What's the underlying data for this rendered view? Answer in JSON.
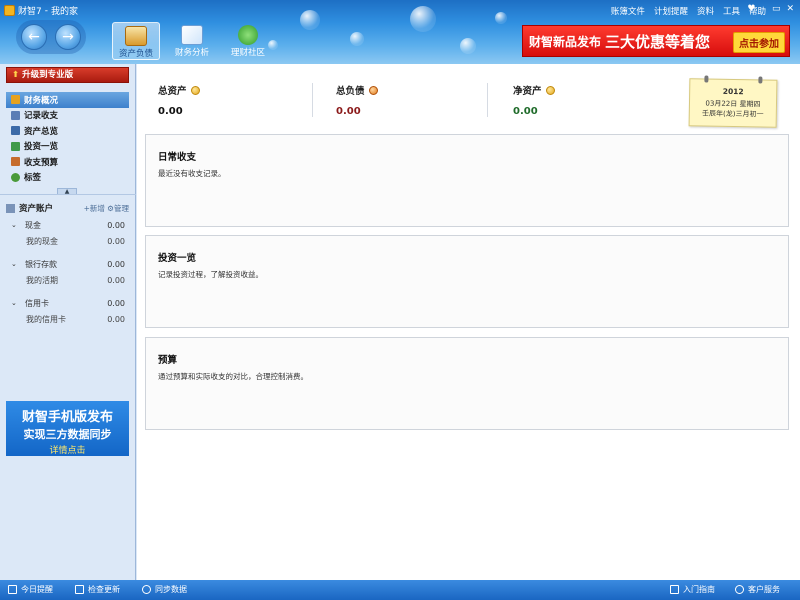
{
  "titlebar": {
    "app_name": "财智7",
    "separator": "-",
    "book_name": "我的家"
  },
  "menu": [
    "账簿文件",
    "计划提醒",
    "资料",
    "工具",
    "帮助"
  ],
  "window_controls": {
    "skin": "♥",
    "minimize": "–",
    "restore": "▭",
    "close": "✕"
  },
  "toolbar": {
    "back_label": "←",
    "forward_label": "→",
    "tools": [
      {
        "label": "资产负债",
        "active": true
      },
      {
        "label": "财务分析",
        "active": false
      },
      {
        "label": "理财社区",
        "active": false
      }
    ]
  },
  "promo": {
    "text": "财智新品发布",
    "highlight": "三大优惠等着您",
    "button": "点击参加"
  },
  "sidebar": {
    "upgrade_label": "升级到专业版",
    "nav": [
      {
        "label": "财务概况",
        "active": true,
        "color": "#e7a21e"
      },
      {
        "label": "记录收支",
        "active": false,
        "color": "#5a7db5"
      },
      {
        "label": "资产总览",
        "active": false,
        "color": "#3b6aa8"
      },
      {
        "label": "投资一览",
        "active": false,
        "color": "#3f9a4a"
      },
      {
        "label": "收支预算",
        "active": false,
        "color": "#c66c2c"
      },
      {
        "label": "标签",
        "active": false,
        "color": "#4a9a3a"
      }
    ],
    "collapse_icon": "▲",
    "accounts": {
      "header": "资产账户",
      "add_label": "+新增",
      "manage_label": "⚙管理",
      "groups": [
        {
          "name": "现金",
          "amount": "0.00",
          "items": [
            {
              "name": "我的现金",
              "amount": "0.00"
            }
          ]
        },
        {
          "name": "银行存款",
          "amount": "0.00",
          "items": [
            {
              "name": "我的活期",
              "amount": "0.00"
            }
          ]
        },
        {
          "name": "信用卡",
          "amount": "0.00",
          "items": [
            {
              "name": "我的信用卡",
              "amount": "0.00"
            }
          ]
        }
      ]
    },
    "banner": {
      "line1": "财智手机版发布",
      "line2": "实现三方数据同步",
      "line3": "详情点击"
    }
  },
  "summary": {
    "total_assets": {
      "label": "总资产",
      "value": "0.00",
      "color": "#111111"
    },
    "total_liabilities": {
      "label": "总负债",
      "value": "0.00",
      "color": "#8b1a1a"
    },
    "net_assets": {
      "label": "净资产",
      "value": "0.00",
      "color": "#1f6b2a"
    }
  },
  "calendar": {
    "year": "2012",
    "date_line": "03月22日 星期四",
    "lunar_line": "壬辰年(龙)三月初一"
  },
  "cards": [
    {
      "title": "日常收支",
      "desc": "最近没有收支记录。"
    },
    {
      "title": "投资一览",
      "desc": "记录投资过程，了解投资收益。"
    },
    {
      "title": "预算",
      "desc": "通过预算和实际收支的对比，合理控制消费。"
    }
  ],
  "statusbar": {
    "today_reminder": "今日提醒",
    "check_update": "检查更新",
    "sync_data": "同步数据",
    "getting_started": "入门指南",
    "customer_service": "客户服务"
  }
}
